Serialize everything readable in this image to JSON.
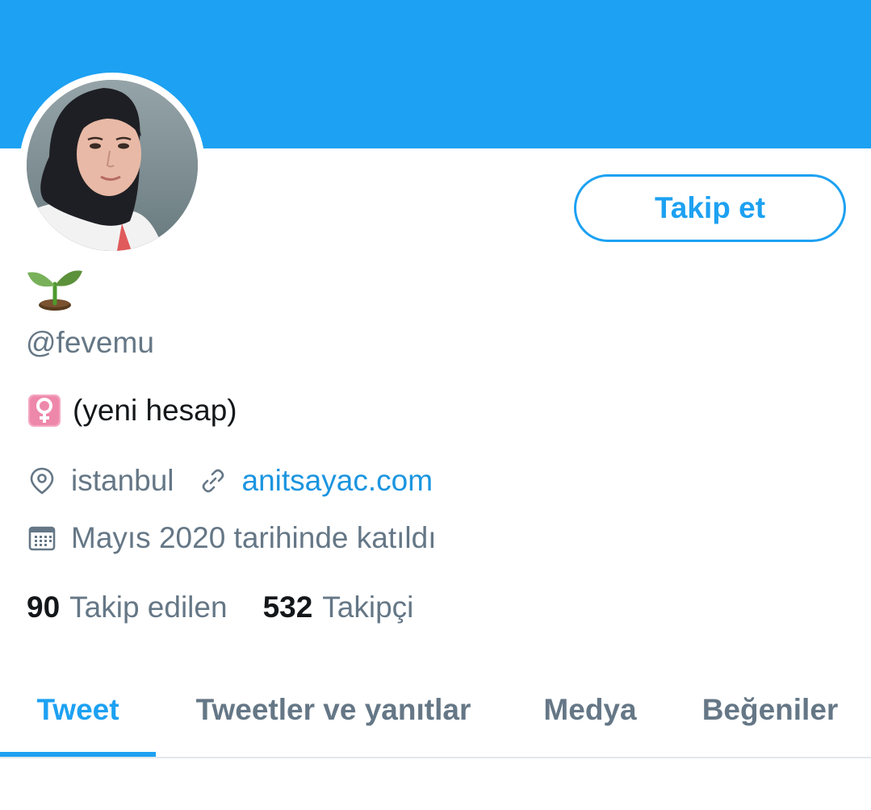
{
  "profile": {
    "handle": "@fevemu",
    "bio_text": "(yeni hesap)",
    "location": "istanbul",
    "website": "anitsayac.com",
    "joined": "Mayıs 2020 tarihinde katıldı",
    "name_emoji": "seedling",
    "bio_emoji": "female-sign"
  },
  "actions": {
    "follow_label": "Takip et"
  },
  "stats": {
    "following_count": "90",
    "following_label": "Takip edilen",
    "followers_count": "532",
    "followers_label": "Takipçi"
  },
  "tabs": [
    {
      "label": "Tweet",
      "active": true
    },
    {
      "label": "Tweetler ve yanıtlar",
      "active": false
    },
    {
      "label": "Medya",
      "active": false
    },
    {
      "label": "Beğeniler",
      "active": false
    }
  ],
  "colors": {
    "accent": "#1da1f2",
    "link": "#1b95e0",
    "secondary_text": "#657786",
    "primary_text": "#14171a"
  },
  "icons": {
    "location": "map-pin-icon",
    "website": "link-icon",
    "joined": "calendar-icon"
  }
}
